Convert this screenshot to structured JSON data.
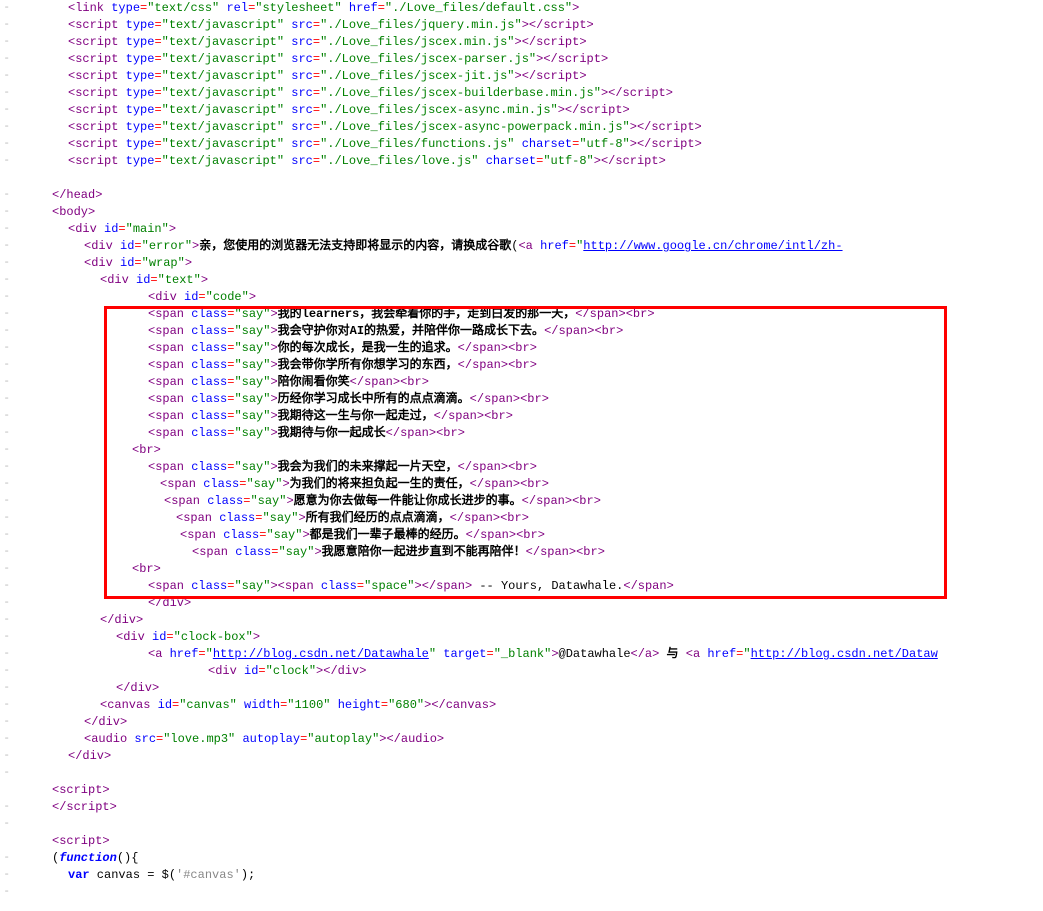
{
  "head": {
    "link": {
      "type": "text/css",
      "rel": "stylesheet",
      "href": "./Love_files/default.css"
    },
    "scripts": [
      {
        "type": "text/javascript",
        "src": "./Love_files/jquery.min.js"
      },
      {
        "type": "text/javascript",
        "src": "./Love_files/jscex.min.js"
      },
      {
        "type": "text/javascript",
        "src": "./Love_files/jscex-parser.js"
      },
      {
        "type": "text/javascript",
        "src": "./Love_files/jscex-jit.js"
      },
      {
        "type": "text/javascript",
        "src": "./Love_files/jscex-builderbase.min.js"
      },
      {
        "type": "text/javascript",
        "src": "./Love_files/jscex-async.min.js"
      },
      {
        "type": "text/javascript",
        "src": "./Love_files/jscex-async-powerpack.min.js"
      },
      {
        "type": "text/javascript",
        "src": "./Love_files/functions.js",
        "charset": "utf-8"
      },
      {
        "type": "text/javascript",
        "src": "./Love_files/love.js",
        "charset": "utf-8"
      }
    ]
  },
  "body": {
    "main_id": "main",
    "error_id": "error",
    "error_text": "亲，您使用的浏览器无法支持即将显示的内容，请换成谷歌",
    "error_paren": "(",
    "error_href": "http://www.google.cn/chrome/intl/zh-",
    "wrap_id": "wrap",
    "text_id": "text",
    "code_id": "code",
    "say_class": "say",
    "space_class": "space",
    "say_lines": [
      "我的learners，我会牵着你的手，走到白发的那一天，",
      "我会守护你对AI的热爱，并陪伴你一路成长下去。",
      "你的每次成长，是我一生的追求。",
      "我会带你学所有你想学习的东西，",
      "陪你闹看你笑",
      "历经你学习成长中所有的点点滴滴。",
      "我期待这一生与你一起走过，",
      "我期待与你一起成长"
    ],
    "say_lines2": [
      "我会为我们的未来撑起一片天空，",
      "为我们的将来担负起一生的责任，",
      "愿意为你去做每一件能让你成长进步的事。",
      "所有我们经历的点点滴滴，",
      "都是我们一辈子最棒的经历。",
      "我愿意陪你一起进步直到不能再陪伴！"
    ],
    "signature": " -- Yours, Datawhale.",
    "clockbox_id": "clock-box",
    "blog_href": "http://blog.csdn.net/Datawhale",
    "blog_target": "_blank",
    "blog_text": "@Datawhale",
    "yu": " 与 ",
    "blog2_href": "http://blog.csdn.net/Dataw",
    "clock_id": "clock",
    "canvas": {
      "id": "canvas",
      "width": "1100",
      "height": "680"
    },
    "audio": {
      "src": "love.mp3",
      "autoplay": "autoplay"
    }
  },
  "js": {
    "fn": "function",
    "open": "(){",
    "var": "var",
    "canvas_var": " canvas = $(",
    "canvas_sel": "'#canvas'",
    "canvas_end": ");"
  },
  "tags": {
    "link": "link",
    "script": "script",
    "head": "head",
    "body": "body",
    "div": "div",
    "span": "span",
    "br": "br",
    "a": "a",
    "canvas": "canvas",
    "audio": "audio"
  },
  "attrs": {
    "type": "type",
    "rel": "rel",
    "href": "href",
    "src": "src",
    "charset": "charset",
    "id": "id",
    "class": "class",
    "target": "target",
    "width": "width",
    "height": "height",
    "autoplay": "autoplay"
  }
}
